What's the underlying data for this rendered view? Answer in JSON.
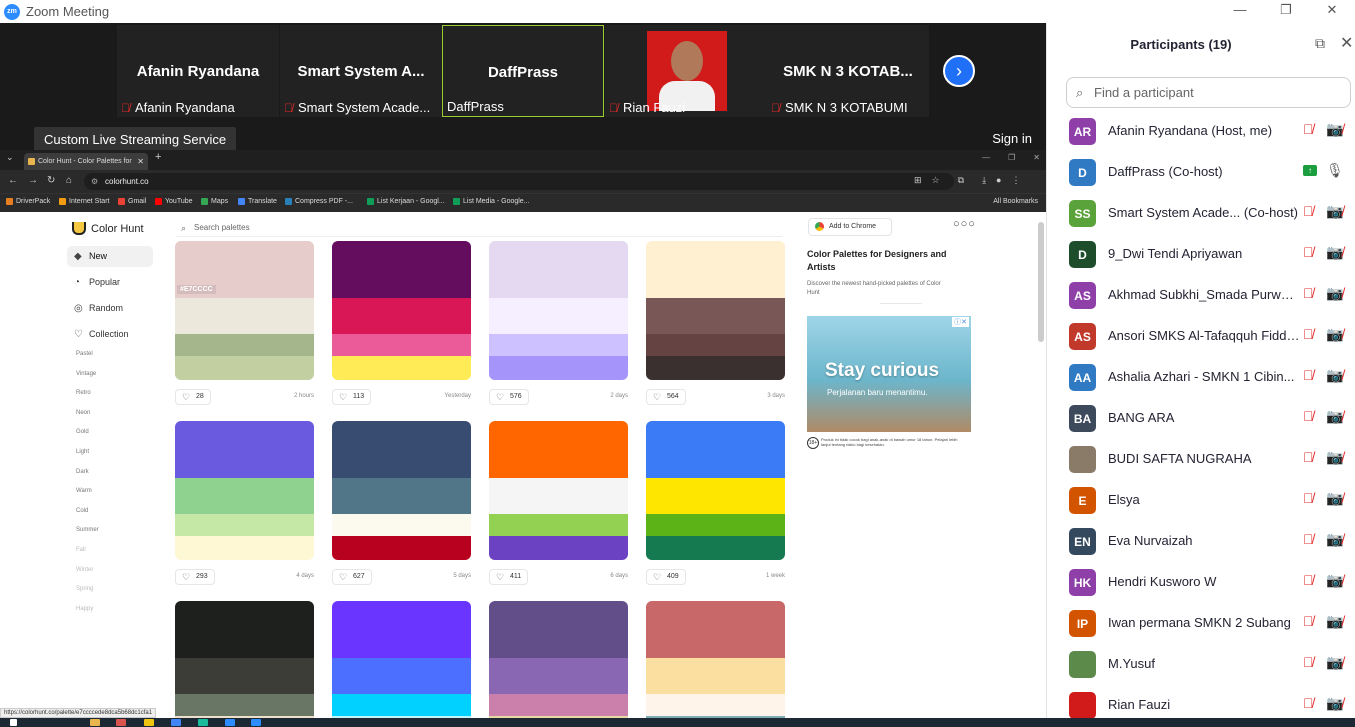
{
  "window": {
    "title": "Zoom Meeting",
    "logo": "zm",
    "controls": [
      "—",
      "❐",
      "✕"
    ]
  },
  "video_strip": {
    "tiles": [
      {
        "big_name": "Afanin Ryandana",
        "label": "Afanin Ryandana",
        "muted": true
      },
      {
        "big_name": "Smart System A...",
        "label": "Smart System Acade...",
        "muted": true
      },
      {
        "big_name": "DaffPrass",
        "label": "DaffPrass",
        "muted": false
      },
      {
        "big_name": "",
        "label": "Rian Fauzi",
        "muted": true
      },
      {
        "big_name": "SMK N 3 KOTAB...",
        "label": "SMK N 3 KOTABUMI",
        "muted": true
      }
    ],
    "next_icon": "chevron-right-icon"
  },
  "share_bar": {
    "stream_label": "Custom Live Streaming Service",
    "signin_label": "Sign in"
  },
  "browser": {
    "tab_title": "Color Hunt - Color Palettes for",
    "url": "colorhunt.co",
    "bookmarks": [
      "DriverPack",
      "Internet Start",
      "Gmail",
      "YouTube",
      "Maps",
      "Translate",
      "Compress PDF -...",
      "List Kerjaan - Googl...",
      "List Media - Google..."
    ],
    "all_bookmarks": "All Bookmarks",
    "status_url": "https://colorhunt.co/palette/e7ccccede8dca5b68dc1cfa1"
  },
  "colorhunt": {
    "logo": "Color Hunt",
    "search_placeholder": "Search palettes",
    "add_to_chrome": "Add to Chrome",
    "sidebar": [
      "New",
      "Popular",
      "Random",
      "Collection"
    ],
    "sidebar_icons": [
      "◆",
      "◔",
      "◎",
      "♡"
    ],
    "tags": [
      "Pastel",
      "Vintage",
      "Retro",
      "Neon",
      "Gold",
      "Light",
      "Dark",
      "Warm",
      "Cold",
      "Summer",
      "Fall",
      "Winter",
      "Spring",
      "Happy"
    ],
    "hex_chip": "#E7CCCC",
    "palettes": [
      {
        "colors": [
          "#E7CCCC",
          "#EDE8DC",
          "#A5B68D",
          "#C1CFA1"
        ],
        "likes": "28",
        "age": "2 hours"
      },
      {
        "colors": [
          "#640D5F",
          "#D91656",
          "#EB5B9A",
          "#FFEB55"
        ],
        "likes": "113",
        "age": "Yesterday"
      },
      {
        "colors": [
          "#E5D9F2",
          "#F5EFFF",
          "#CDC1FF",
          "#A594F9"
        ],
        "likes": "576",
        "age": "2 days"
      },
      {
        "colors": [
          "#FFF0D1",
          "#795757",
          "#664343",
          "#3B3030"
        ],
        "likes": "564",
        "age": "3 days"
      },
      {
        "colors": [
          "#6A5AE0",
          "#8FD18F",
          "#C5E8A6",
          "#FFF8D5"
        ],
        "likes": "293",
        "age": "4 days"
      },
      {
        "colors": [
          "#384B70",
          "#507687",
          "#FCFAEE",
          "#B8001F"
        ],
        "likes": "627",
        "age": "5 days"
      },
      {
        "colors": [
          "#FF6600",
          "#F5F5F5",
          "#93D152",
          "#6A42C2"
        ],
        "likes": "411",
        "age": "6 days"
      },
      {
        "colors": [
          "#3B7BF5",
          "#FFE600",
          "#5BB318",
          "#157A50"
        ],
        "likes": "409",
        "age": "1 week"
      },
      {
        "colors": [
          "#1E201E",
          "#3C3D37",
          "#697565",
          "#ECDFCC"
        ],
        "likes": "",
        "age": ""
      },
      {
        "colors": [
          "#6A35FF",
          "#4C6FFF",
          "#00D1FF",
          "#BFF4FF"
        ],
        "likes": "",
        "age": ""
      },
      {
        "colors": [
          "#624E88",
          "#8967B3",
          "#CB80AB",
          "#E6D9A2"
        ],
        "likes": "",
        "age": ""
      },
      {
        "colors": [
          "#C96868",
          "#FADFA1",
          "#FFF4EA",
          "#7EACB5"
        ],
        "likes": "",
        "age": ""
      }
    ],
    "ad": {
      "title": "Color Palettes for Designers and Artists",
      "subtitle": "Discover the newest hand-picked palettes of Color Hunt",
      "headline": "Stay curious",
      "tagline": "Perjalanan baru menantimu.",
      "badge": "18+",
      "footnote": "Produk ini tidak cocok bagi anak-anak di bawah umur 18 tahun. Pelajari lebih lanjut tentang risiko bagi kesehatan."
    }
  },
  "participants": {
    "title": "Participants (19)",
    "search_placeholder": "Find a participant",
    "list": [
      {
        "initials": "AR",
        "name": "Afanin Ryandana (Host, me)",
        "color": "#8e3fa8",
        "mic": "muted",
        "video": "off"
      },
      {
        "initials": "D",
        "name": "DaffPrass (Co-host)",
        "color": "#2f7ac2",
        "mic": "on",
        "video": "share"
      },
      {
        "initials": "SS",
        "name": "Smart System Acade...  (Co-host)",
        "color": "#5aa23a",
        "mic": "muted",
        "video": "off"
      },
      {
        "initials": "D",
        "name": "9_Dwi Tendi Apriyawan",
        "color": "#1e4d2b",
        "mic": "muted",
        "video": "off"
      },
      {
        "initials": "AS",
        "name": "Akhmad Subkhi_Smada Purwok...",
        "color": "#8e3fa8",
        "mic": "muted",
        "video": "off"
      },
      {
        "initials": "AS",
        "name": "Ansori SMKS Al-Tafaqquh Fiddi...",
        "color": "#c0392b",
        "mic": "muted",
        "video": "off"
      },
      {
        "initials": "AA",
        "name": "Ashalia Azhari - SMKN 1 Cibin...",
        "color": "#2f7ac2",
        "mic": "muted",
        "video": "off"
      },
      {
        "initials": "BA",
        "name": "BANG ARA",
        "color": "#3d4a5c",
        "mic": "muted",
        "video": "off"
      },
      {
        "initials": "",
        "name": "BUDI SAFTA NUGRAHA",
        "color": "#8a7a68",
        "mic": "muted",
        "video": "off"
      },
      {
        "initials": "E",
        "name": "Elsya",
        "color": "#d35400",
        "mic": "muted",
        "video": "off"
      },
      {
        "initials": "EN",
        "name": "Eva Nurvaizah",
        "color": "#34495e",
        "mic": "muted",
        "video": "off"
      },
      {
        "initials": "HK",
        "name": "Hendri Kusworo W",
        "color": "#8e3fa8",
        "mic": "muted",
        "video": "off"
      },
      {
        "initials": "IP",
        "name": "Iwan permana SMKN 2 Subang",
        "color": "#d35400",
        "mic": "muted",
        "video": "off"
      },
      {
        "initials": "",
        "name": "M.Yusuf",
        "color": "#5c8a4a",
        "mic": "muted",
        "video": "off"
      },
      {
        "initials": "",
        "name": "Rian Fauzi",
        "color": "#d11a1a",
        "mic": "muted",
        "video": "off"
      }
    ]
  }
}
